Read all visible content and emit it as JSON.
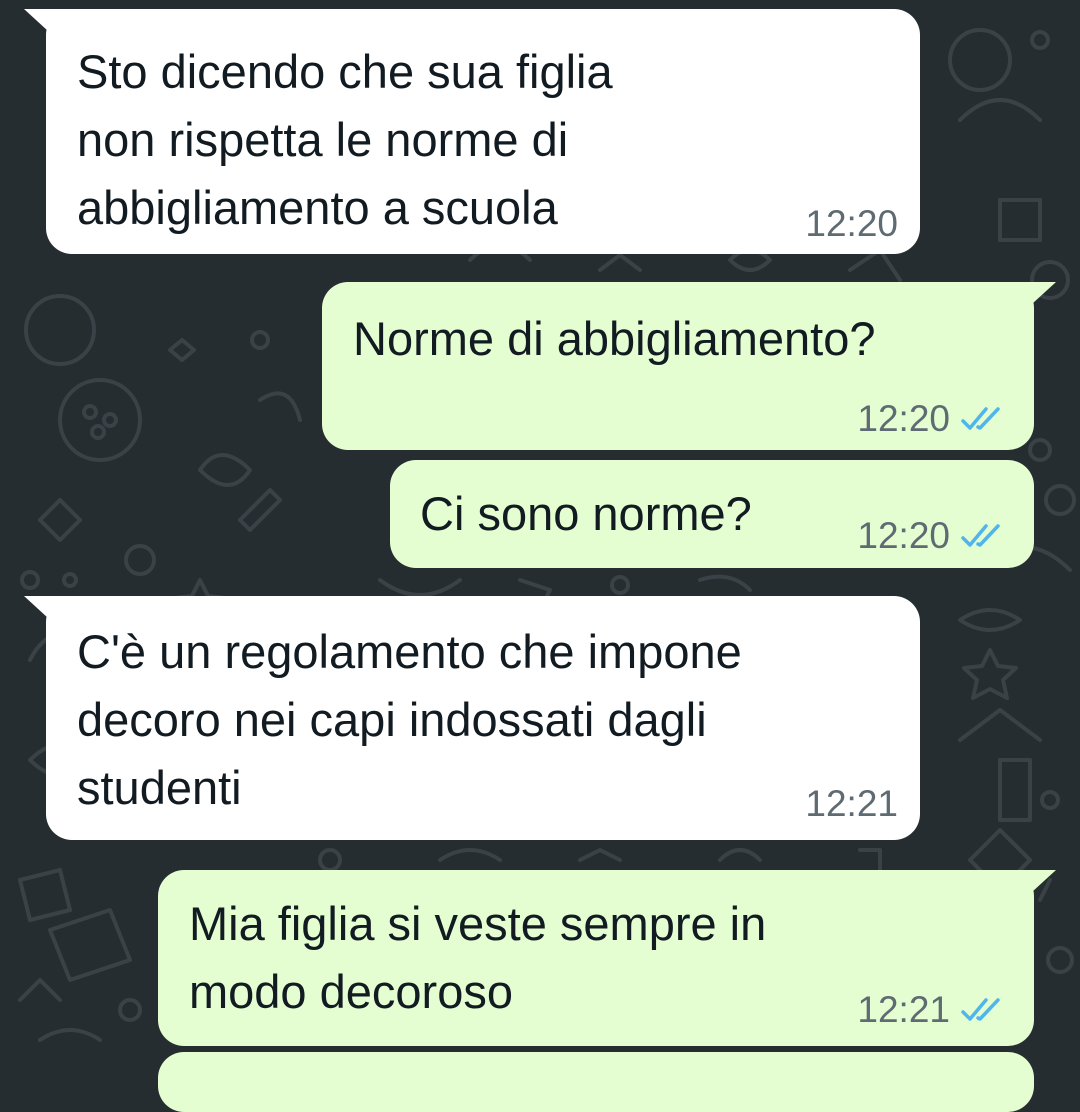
{
  "conversation": {
    "messages": [
      {
        "direction": "incoming",
        "text": "Sto dicendo che sua figlia\nnon rispetta le norme di\nabbigliamento a scuola",
        "time": "12:20"
      },
      {
        "direction": "outgoing",
        "text": "Norme di abbigliamento?",
        "time": "12:20",
        "status": "read"
      },
      {
        "direction": "outgoing",
        "text": "Ci sono norme?",
        "time": "12:20",
        "status": "read"
      },
      {
        "direction": "incoming",
        "text": "C'è un regolamento che impone\ndecoro nei capi indossati dagli\nstudenti",
        "time": "12:21"
      },
      {
        "direction": "outgoing",
        "text": "Mia figlia si veste sempre in\nmodo decoroso",
        "time": "12:21",
        "status": "read"
      }
    ]
  },
  "colors": {
    "background": "#262d31",
    "incoming_bubble": "#ffffff",
    "outgoing_bubble": "#e4fdd1",
    "read_ticks": "#4fb6ec",
    "timestamp": "#5f6b72"
  },
  "icons": {
    "read_receipt": "double-check-icon"
  }
}
